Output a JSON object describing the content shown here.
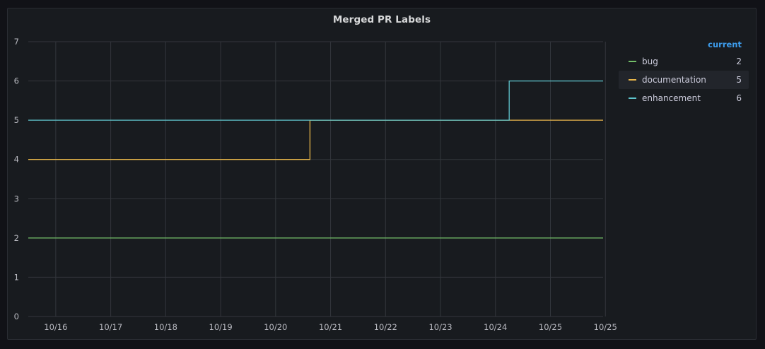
{
  "panel": {
    "title": "Merged PR Labels"
  },
  "legend": {
    "header": "current",
    "items": [
      {
        "name": "bug",
        "current": "2",
        "color": "#73bf69"
      },
      {
        "name": "documentation",
        "current": "5",
        "color": "#e8b64a"
      },
      {
        "name": "enhancement",
        "current": "6",
        "color": "#5ec4cc"
      }
    ]
  },
  "chart_data": {
    "type": "line",
    "title": "Merged PR Labels",
    "xlabel": "",
    "ylabel": "",
    "ylim": [
      0,
      7
    ],
    "y_ticks": [
      "0",
      "1",
      "2",
      "3",
      "4",
      "5",
      "6",
      "7"
    ],
    "x_tick_labels": [
      "10/16",
      "10/17",
      "10/18",
      "10/19",
      "10/20",
      "10/21",
      "10/22",
      "10/23",
      "10/24",
      "10/25",
      "10/25"
    ],
    "xlim": [
      "2023-10-15T12:00",
      "2023-10-25T23:00"
    ],
    "x_ticks": [
      "2023-10-16T00:00",
      "2023-10-17T00:00",
      "2023-10-18T00:00",
      "2023-10-19T00:00",
      "2023-10-20T00:00",
      "2023-10-21T00:00",
      "2023-10-22T00:00",
      "2023-10-23T00:00",
      "2023-10-24T00:00",
      "2023-10-25T00:00",
      "2023-10-26T00:00"
    ],
    "grid": true,
    "legend_position": "right",
    "series": [
      {
        "name": "bug",
        "color": "#73bf69",
        "points": [
          [
            "2023-10-15T12:00",
            2
          ],
          [
            "2023-10-25T23:00",
            2
          ]
        ]
      },
      {
        "name": "documentation",
        "color": "#e8b64a",
        "points": [
          [
            "2023-10-15T12:00",
            4
          ],
          [
            "2023-10-20T15:00",
            4
          ],
          [
            "2023-10-20T15:00",
            5
          ],
          [
            "2023-10-25T23:00",
            5
          ]
        ]
      },
      {
        "name": "enhancement",
        "color": "#5ec4cc",
        "points": [
          [
            "2023-10-15T12:00",
            5
          ],
          [
            "2023-10-24T06:00",
            5
          ],
          [
            "2023-10-24T06:00",
            6
          ],
          [
            "2023-10-25T23:00",
            6
          ]
        ]
      }
    ]
  }
}
